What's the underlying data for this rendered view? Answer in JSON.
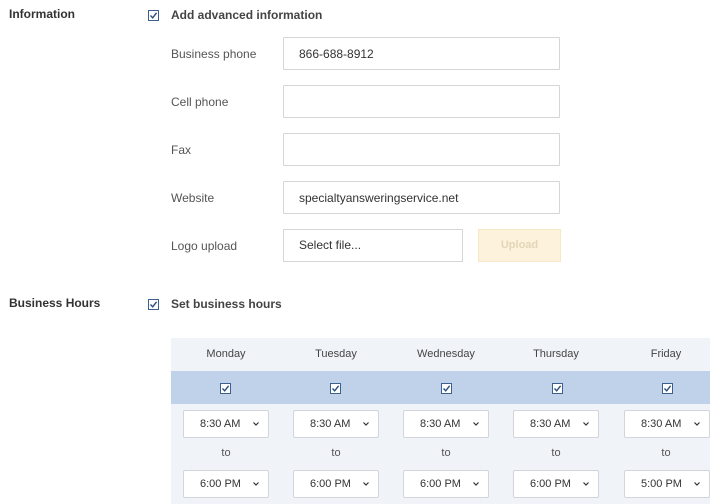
{
  "information": {
    "section_label": "Information",
    "advanced_checkbox_label": "Add advanced information",
    "fields": {
      "business_phone": {
        "label": "Business phone",
        "value": "866-688-8912"
      },
      "cell_phone": {
        "label": "Cell phone",
        "value": ""
      },
      "fax": {
        "label": "Fax",
        "value": ""
      },
      "website": {
        "label": "Website",
        "value": "specialtyansweringservice.net"
      }
    },
    "logo": {
      "label": "Logo upload",
      "file_text": "Select file...",
      "upload_label": "Upload"
    }
  },
  "business_hours": {
    "section_label": "Business Hours",
    "checkbox_label": "Set business hours",
    "to_label": "to",
    "days": [
      {
        "name": "Monday",
        "open": "8:30 AM",
        "close": "6:00 PM"
      },
      {
        "name": "Tuesday",
        "open": "8:30 AM",
        "close": "6:00 PM"
      },
      {
        "name": "Wednesday",
        "open": "8:30 AM",
        "close": "6:00 PM"
      },
      {
        "name": "Thursday",
        "open": "8:30 AM",
        "close": "6:00 PM"
      },
      {
        "name": "Friday",
        "open": "8:30 AM",
        "close": "5:00 PM"
      }
    ]
  },
  "colors": {
    "checkbox_border": "#3b5f8f",
    "hours_panel_bg": "#f0f4f9",
    "hours_checkbox_band": "#c0d1ea",
    "upload_button_bg": "#fdf3dc"
  }
}
